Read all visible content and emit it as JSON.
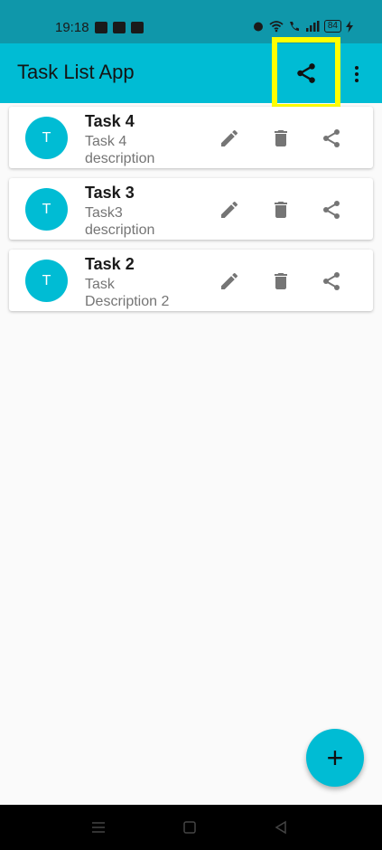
{
  "status_bar": {
    "time": "19:18",
    "battery": "84"
  },
  "app_bar": {
    "title": "Task List App"
  },
  "tasks": [
    {
      "avatar": "T",
      "title": "Task 4",
      "description": "Task 4 description"
    },
    {
      "avatar": "T",
      "title": "Task 3",
      "description": "Task3 description"
    },
    {
      "avatar": "T",
      "title": "Task 2",
      "description": "Task Description 2"
    }
  ],
  "fab": {
    "label": "+"
  },
  "colors": {
    "primary": "#00bcd4",
    "status_bar": "#0f97aa",
    "highlight": "#ffff00",
    "icon_gray": "#757575"
  },
  "icons": {
    "edit": "pencil-icon",
    "delete": "trash-icon",
    "share": "share-icon",
    "more": "more-vert-icon",
    "add": "plus-icon"
  }
}
